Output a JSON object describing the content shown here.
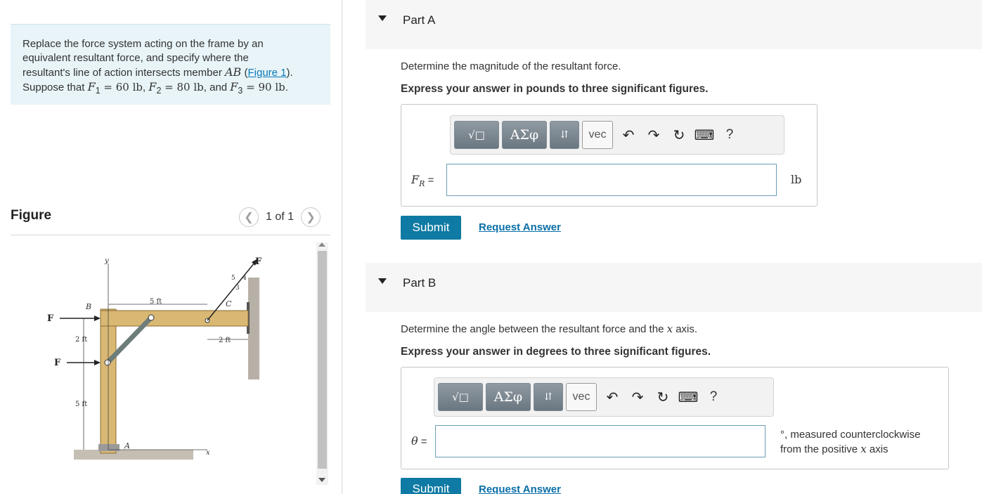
{
  "problem": {
    "line1": "Replace the force system acting on the frame by an",
    "line2": "equivalent resultant force, and specify where the",
    "line3_pre": "resultant's line of action intersects member ",
    "member": "AB",
    "figure_link": "Figure 1",
    "line4_pre": "Suppose that ",
    "f1_sym": "F",
    "f1_sub": "1",
    "f1_val": " = 60 lb",
    "f2_sym": "F",
    "f2_sub": "2",
    "f2_val": " = 80 lb",
    "f3_sym": "F",
    "f3_sub": "3",
    "f3_val": " = 90 lb",
    "and": ", and ",
    "comma": ", ",
    "period": "."
  },
  "figure": {
    "title": "Figure",
    "pager": "1 of 1",
    "labels": {
      "B": "B",
      "C": "C",
      "A": "A",
      "x": "x",
      "y": "y",
      "F1": "F",
      "F2": "F",
      "F3": "F",
      "dim5ft_top": "5 ft",
      "dim2ft_left": "2 ft",
      "dim5ft_left": "5 ft",
      "dim2ft_right": "2 ft",
      "tri5": "5",
      "tri4": "4",
      "tri3": "3"
    }
  },
  "partA": {
    "label": "Part A",
    "question": "Determine the magnitude of the resultant force.",
    "instruction": "Express your answer in pounds to three significant figures.",
    "var": "F",
    "var_sub": "R",
    "equals": " =",
    "input_value": "",
    "unit": "lb",
    "submit": "Submit",
    "request": "Request Answer"
  },
  "partB": {
    "label": "Part B",
    "question_pre": "Determine the angle between the resultant force and the ",
    "question_var": "x",
    "question_post": " axis.",
    "instruction": "Express your answer in degrees to three significant figures.",
    "var": "θ",
    "equals": " =",
    "input_value": "",
    "unit_line1": "°, measured counterclockwise",
    "unit_line2_pre": "from the positive ",
    "unit_line2_var": "x",
    "unit_line2_post": " axis",
    "submit": "Submit",
    "request": "Request Answer"
  },
  "toolbar": {
    "templates": "√□",
    "greek": "ΑΣφ",
    "arrows": "⇵",
    "vec": "vec",
    "help": "?"
  },
  "colors": {
    "problem_bg": "#e8f4f8",
    "submit_bg": "#0f7aa3",
    "link": "#0a6fa8",
    "wood": "#d9b873"
  }
}
